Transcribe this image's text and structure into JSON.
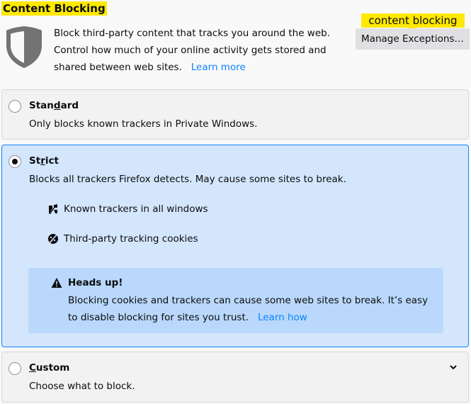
{
  "section": {
    "title": "Content Blocking"
  },
  "intro": {
    "text": "Block third-party content that tracks you around the web. Control how much of your online activity gets stored and shared between web sites.",
    "learn_more": "Learn more"
  },
  "tooltip": {
    "text": "content blocking"
  },
  "manage_button": {
    "label": "Manage Exceptions…"
  },
  "options": {
    "standard": {
      "title_pre": "Stan",
      "title_access": "d",
      "title_post": "ard",
      "description": "Only blocks known trackers in Private Windows.",
      "selected": false
    },
    "strict": {
      "title_pre": "St",
      "title_access": "r",
      "title_post": "ict",
      "description": "Blocks all trackers Firefox detects. May cause some sites to break.",
      "selected": true,
      "features": [
        "Known trackers in all windows",
        "Third-party tracking cookies"
      ],
      "warning": {
        "title": "Heads up!",
        "text": "Blocking cookies and trackers can cause some web sites to break. It’s easy to disable blocking for sites you trust.",
        "link": "Learn how"
      }
    },
    "custom": {
      "title_pre": "",
      "title_access": "C",
      "title_post": "ustom",
      "description": "Choose what to block.",
      "selected": false
    }
  },
  "colors": {
    "accent": "#0a84ff",
    "highlight": "#ffe900",
    "selected_bg": "#d3e6fc",
    "warning_bg": "#b9d8fb"
  }
}
